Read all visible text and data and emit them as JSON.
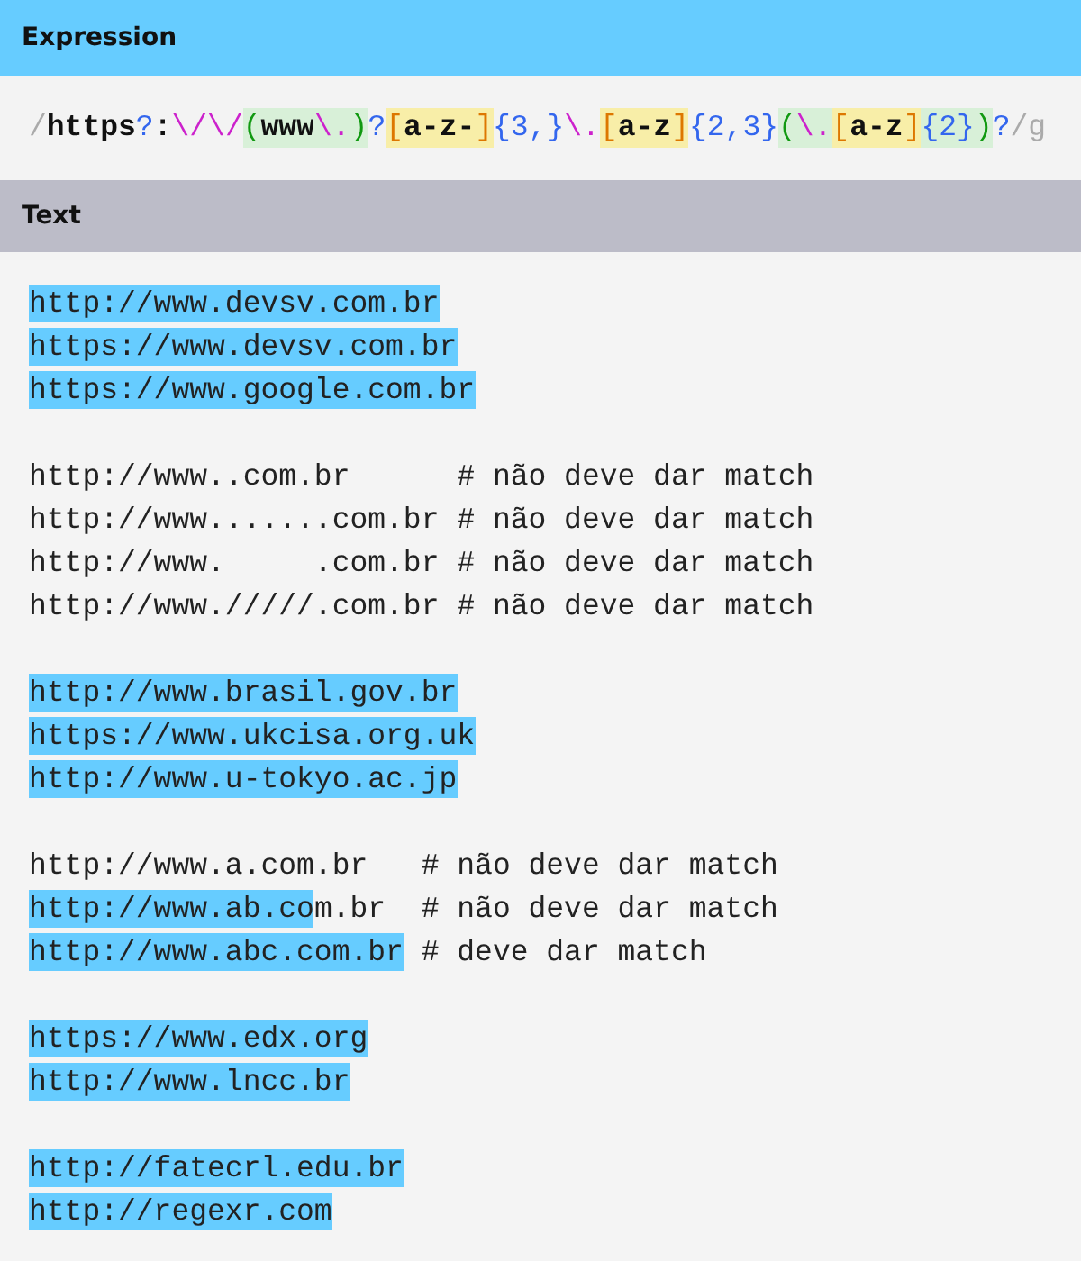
{
  "expression_header": {
    "title": "Expression"
  },
  "expression": [
    {
      "text": "/",
      "kind": "delim",
      "in_group": false,
      "in_set": false
    },
    {
      "text": "https",
      "kind": "literal",
      "in_group": false,
      "in_set": false
    },
    {
      "text": "?",
      "kind": "quant",
      "in_group": false,
      "in_set": false
    },
    {
      "text": ":",
      "kind": "literal",
      "in_group": false,
      "in_set": false
    },
    {
      "text": "\\/",
      "kind": "escape",
      "in_group": false,
      "in_set": false
    },
    {
      "text": "\\/",
      "kind": "escape",
      "in_group": false,
      "in_set": false
    },
    {
      "text": "(",
      "kind": "group",
      "in_group": true,
      "in_set": false
    },
    {
      "text": "www",
      "kind": "literal",
      "in_group": true,
      "in_set": false
    },
    {
      "text": "\\.",
      "kind": "escape",
      "in_group": true,
      "in_set": false
    },
    {
      "text": ")",
      "kind": "group",
      "in_group": true,
      "in_set": false
    },
    {
      "text": "?",
      "kind": "quant",
      "in_group": false,
      "in_set": false
    },
    {
      "text": "[",
      "kind": "set",
      "in_set": true
    },
    {
      "text": "a-z-",
      "kind": "literal",
      "in_set": true
    },
    {
      "text": "]",
      "kind": "set",
      "in_set": true
    },
    {
      "text": "{3,}",
      "kind": "quant",
      "in_group": false,
      "in_set": false
    },
    {
      "text": "\\.",
      "kind": "escape",
      "in_group": false,
      "in_set": false
    },
    {
      "text": "[",
      "kind": "set",
      "in_set": true
    },
    {
      "text": "a-z",
      "kind": "literal",
      "in_set": true
    },
    {
      "text": "]",
      "kind": "set",
      "in_set": true
    },
    {
      "text": "{2,3}",
      "kind": "quant",
      "in_group": false,
      "in_set": false
    },
    {
      "text": "(",
      "kind": "group",
      "in_group": true,
      "in_set": false
    },
    {
      "text": "\\.",
      "kind": "escape",
      "in_group": true,
      "in_set": false
    },
    {
      "text": "[",
      "kind": "set",
      "in_set": true
    },
    {
      "text": "a-z",
      "kind": "literal",
      "in_set": true
    },
    {
      "text": "]",
      "kind": "set",
      "in_set": true
    },
    {
      "text": "{2}",
      "kind": "quant",
      "in_group": true,
      "in_set": false
    },
    {
      "text": ")",
      "kind": "group",
      "in_group": true,
      "in_set": false
    },
    {
      "text": "?",
      "kind": "quant",
      "in_group": false,
      "in_set": false
    },
    {
      "text": "/g",
      "kind": "delim",
      "in_group": false,
      "in_set": false
    }
  ],
  "text_header": {
    "title": "Text"
  },
  "blocks": [
    {
      "lines": [
        {
          "segments": [
            {
              "text": "http://www.devsv.com.br",
              "match": true
            }
          ]
        },
        {
          "segments": [
            {
              "text": "https://www.devsv.com.br",
              "match": true
            }
          ]
        },
        {
          "segments": [
            {
              "text": "https://www.google.com.br",
              "match": true
            }
          ]
        }
      ]
    },
    {
      "lines": [
        {
          "segments": [
            {
              "text": "http://www..com.br      # não deve dar match",
              "match": false
            }
          ]
        },
        {
          "segments": [
            {
              "text": "http://www.......com.br # não deve dar match",
              "match": false
            }
          ]
        },
        {
          "segments": [
            {
              "text": "http://www.     .com.br # não deve dar match",
              "match": false
            }
          ]
        },
        {
          "segments": [
            {
              "text": "http://www./////.com.br # não deve dar match",
              "match": false
            }
          ]
        }
      ]
    },
    {
      "lines": [
        {
          "segments": [
            {
              "text": "http://www.brasil.gov.br",
              "match": true
            }
          ]
        },
        {
          "segments": [
            {
              "text": "https://www.ukcisa.org.uk",
              "match": true
            }
          ]
        },
        {
          "segments": [
            {
              "text": "http://www.u-tokyo.ac.jp",
              "match": true
            }
          ]
        }
      ]
    },
    {
      "lines": [
        {
          "segments": [
            {
              "text": "http://www.a.com.br   # não deve dar match",
              "match": false
            }
          ]
        },
        {
          "segments": [
            {
              "text": "http://www.ab.co",
              "match": true
            },
            {
              "text": "m.br  # não deve dar match",
              "match": false
            }
          ]
        },
        {
          "segments": [
            {
              "text": "http://www.abc.com.br",
              "match": true
            },
            {
              "text": " # deve dar match",
              "match": false
            }
          ]
        }
      ]
    },
    {
      "lines": [
        {
          "segments": [
            {
              "text": "https://www.edx.org",
              "match": true
            }
          ]
        },
        {
          "segments": [
            {
              "text": "http://www.lncc.br",
              "match": true
            }
          ]
        }
      ]
    },
    {
      "lines": [
        {
          "segments": [
            {
              "text": "http://fatecrl.edu.br",
              "match": true
            }
          ]
        },
        {
          "segments": [
            {
              "text": "http://regexr.com",
              "match": true
            }
          ]
        }
      ]
    }
  ]
}
